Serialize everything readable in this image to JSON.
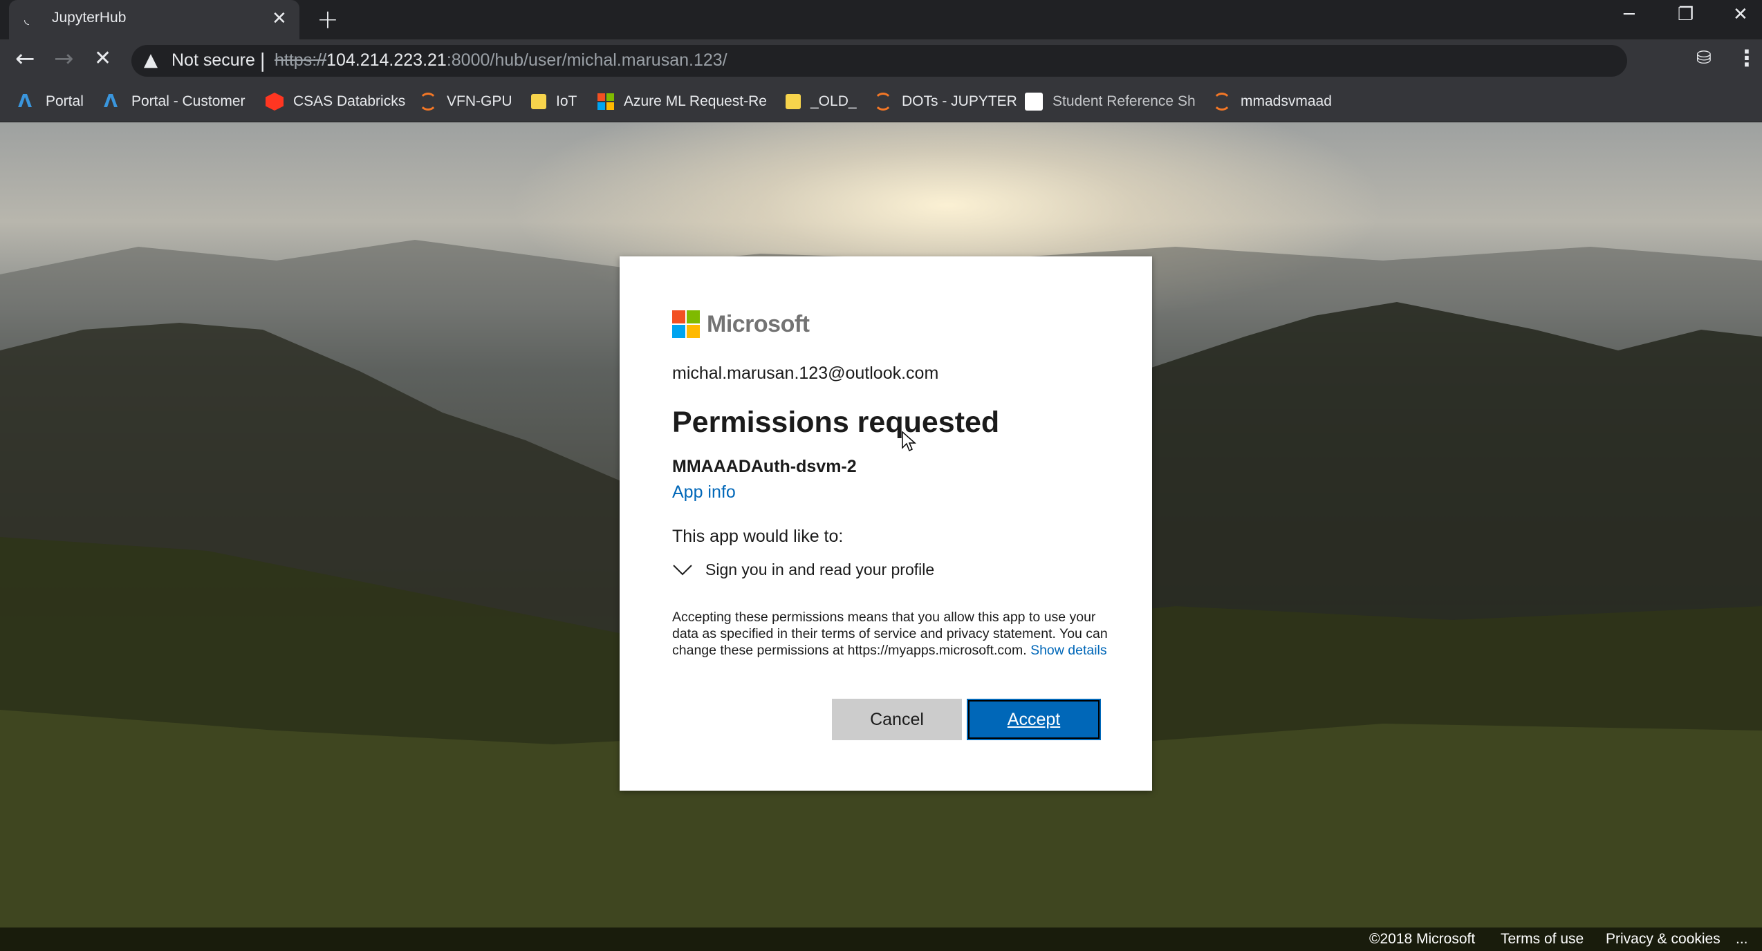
{
  "browser": {
    "tab_title": "JupyterHub",
    "security_label": "Not secure",
    "url_scheme": "https://",
    "url_host": "104.214.223.21",
    "url_path": ":8000/hub/user/michal.marusan.123/",
    "bookmarks": [
      {
        "label": "Portal",
        "icon": "azure-icon"
      },
      {
        "label": "Portal - Customer",
        "icon": "azure-icon"
      },
      {
        "label": "CSAS Databricks",
        "icon": "databricks-icon"
      },
      {
        "label": "VFN-GPU",
        "icon": "jupyter-icon"
      },
      {
        "label": "IoT",
        "icon": "folder-icon"
      },
      {
        "label": "Azure ML Request-Re",
        "icon": "microsoft-icon"
      },
      {
        "label": "_OLD_",
        "icon": "folder-icon"
      },
      {
        "label": "DOTs - JUPYTER",
        "icon": "jupyter-icon"
      },
      {
        "label": "Student Reference Sh",
        "icon": "sheet-icon"
      },
      {
        "label": "mmadsvmaad",
        "icon": "jupyter-icon"
      }
    ]
  },
  "dialog": {
    "brand": "Microsoft",
    "account": "michal.marusan.123@outlook.com",
    "title": "Permissions requested",
    "app_name": "MMAAADAuth-dsvm-2",
    "app_info_link": "App info",
    "would_like": "This app would like to:",
    "permission": "Sign you in and read your profile",
    "legal_text": "Accepting these permissions means that you allow this app to use your data as specified in their terms of service and privacy statement. You can change these permissions at https://myapps.microsoft.com.",
    "show_details_link": "Show details",
    "cancel_label": "Cancel",
    "accept_label": "Accept"
  },
  "footer": {
    "copyright": "©2018 Microsoft",
    "terms": "Terms of use",
    "privacy": "Privacy & cookies",
    "more": "..."
  },
  "colors": {
    "accent": "#0067b8",
    "ms_red": "#f25022",
    "ms_green": "#7fba00",
    "ms_blue": "#00a4ef",
    "ms_yellow": "#ffb900"
  }
}
